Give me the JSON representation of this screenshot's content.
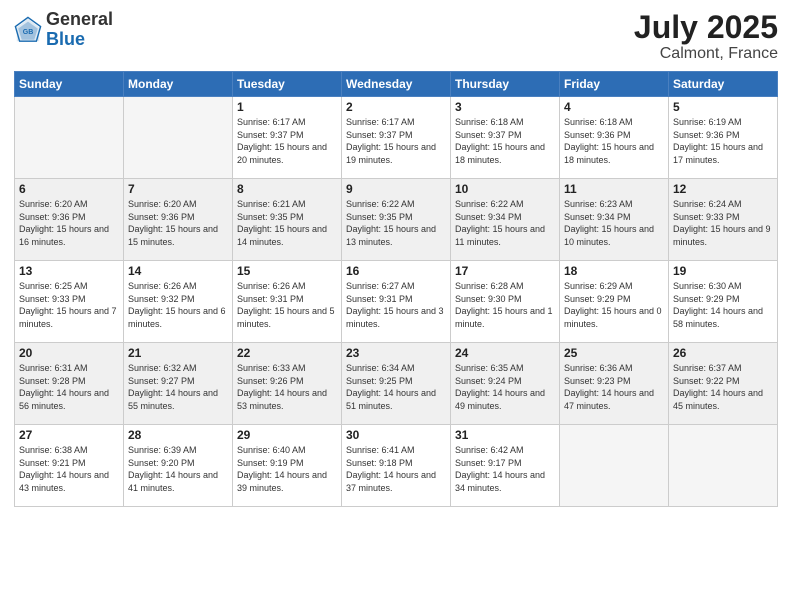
{
  "logo": {
    "general": "General",
    "blue": "Blue"
  },
  "header": {
    "month": "July 2025",
    "location": "Calmont, France"
  },
  "weekdays": [
    "Sunday",
    "Monday",
    "Tuesday",
    "Wednesday",
    "Thursday",
    "Friday",
    "Saturday"
  ],
  "weeks": [
    [
      {
        "day": "",
        "empty": true
      },
      {
        "day": "",
        "empty": true
      },
      {
        "day": "1",
        "sunrise": "Sunrise: 6:17 AM",
        "sunset": "Sunset: 9:37 PM",
        "daylight": "Daylight: 15 hours and 20 minutes."
      },
      {
        "day": "2",
        "sunrise": "Sunrise: 6:17 AM",
        "sunset": "Sunset: 9:37 PM",
        "daylight": "Daylight: 15 hours and 19 minutes."
      },
      {
        "day": "3",
        "sunrise": "Sunrise: 6:18 AM",
        "sunset": "Sunset: 9:37 PM",
        "daylight": "Daylight: 15 hours and 18 minutes."
      },
      {
        "day": "4",
        "sunrise": "Sunrise: 6:18 AM",
        "sunset": "Sunset: 9:36 PM",
        "daylight": "Daylight: 15 hours and 18 minutes."
      },
      {
        "day": "5",
        "sunrise": "Sunrise: 6:19 AM",
        "sunset": "Sunset: 9:36 PM",
        "daylight": "Daylight: 15 hours and 17 minutes."
      }
    ],
    [
      {
        "day": "6",
        "sunrise": "Sunrise: 6:20 AM",
        "sunset": "Sunset: 9:36 PM",
        "daylight": "Daylight: 15 hours and 16 minutes."
      },
      {
        "day": "7",
        "sunrise": "Sunrise: 6:20 AM",
        "sunset": "Sunset: 9:36 PM",
        "daylight": "Daylight: 15 hours and 15 minutes."
      },
      {
        "day": "8",
        "sunrise": "Sunrise: 6:21 AM",
        "sunset": "Sunset: 9:35 PM",
        "daylight": "Daylight: 15 hours and 14 minutes."
      },
      {
        "day": "9",
        "sunrise": "Sunrise: 6:22 AM",
        "sunset": "Sunset: 9:35 PM",
        "daylight": "Daylight: 15 hours and 13 minutes."
      },
      {
        "day": "10",
        "sunrise": "Sunrise: 6:22 AM",
        "sunset": "Sunset: 9:34 PM",
        "daylight": "Daylight: 15 hours and 11 minutes."
      },
      {
        "day": "11",
        "sunrise": "Sunrise: 6:23 AM",
        "sunset": "Sunset: 9:34 PM",
        "daylight": "Daylight: 15 hours and 10 minutes."
      },
      {
        "day": "12",
        "sunrise": "Sunrise: 6:24 AM",
        "sunset": "Sunset: 9:33 PM",
        "daylight": "Daylight: 15 hours and 9 minutes."
      }
    ],
    [
      {
        "day": "13",
        "sunrise": "Sunrise: 6:25 AM",
        "sunset": "Sunset: 9:33 PM",
        "daylight": "Daylight: 15 hours and 7 minutes."
      },
      {
        "day": "14",
        "sunrise": "Sunrise: 6:26 AM",
        "sunset": "Sunset: 9:32 PM",
        "daylight": "Daylight: 15 hours and 6 minutes."
      },
      {
        "day": "15",
        "sunrise": "Sunrise: 6:26 AM",
        "sunset": "Sunset: 9:31 PM",
        "daylight": "Daylight: 15 hours and 5 minutes."
      },
      {
        "day": "16",
        "sunrise": "Sunrise: 6:27 AM",
        "sunset": "Sunset: 9:31 PM",
        "daylight": "Daylight: 15 hours and 3 minutes."
      },
      {
        "day": "17",
        "sunrise": "Sunrise: 6:28 AM",
        "sunset": "Sunset: 9:30 PM",
        "daylight": "Daylight: 15 hours and 1 minute."
      },
      {
        "day": "18",
        "sunrise": "Sunrise: 6:29 AM",
        "sunset": "Sunset: 9:29 PM",
        "daylight": "Daylight: 15 hours and 0 minutes."
      },
      {
        "day": "19",
        "sunrise": "Sunrise: 6:30 AM",
        "sunset": "Sunset: 9:29 PM",
        "daylight": "Daylight: 14 hours and 58 minutes."
      }
    ],
    [
      {
        "day": "20",
        "sunrise": "Sunrise: 6:31 AM",
        "sunset": "Sunset: 9:28 PM",
        "daylight": "Daylight: 14 hours and 56 minutes."
      },
      {
        "day": "21",
        "sunrise": "Sunrise: 6:32 AM",
        "sunset": "Sunset: 9:27 PM",
        "daylight": "Daylight: 14 hours and 55 minutes."
      },
      {
        "day": "22",
        "sunrise": "Sunrise: 6:33 AM",
        "sunset": "Sunset: 9:26 PM",
        "daylight": "Daylight: 14 hours and 53 minutes."
      },
      {
        "day": "23",
        "sunrise": "Sunrise: 6:34 AM",
        "sunset": "Sunset: 9:25 PM",
        "daylight": "Daylight: 14 hours and 51 minutes."
      },
      {
        "day": "24",
        "sunrise": "Sunrise: 6:35 AM",
        "sunset": "Sunset: 9:24 PM",
        "daylight": "Daylight: 14 hours and 49 minutes."
      },
      {
        "day": "25",
        "sunrise": "Sunrise: 6:36 AM",
        "sunset": "Sunset: 9:23 PM",
        "daylight": "Daylight: 14 hours and 47 minutes."
      },
      {
        "day": "26",
        "sunrise": "Sunrise: 6:37 AM",
        "sunset": "Sunset: 9:22 PM",
        "daylight": "Daylight: 14 hours and 45 minutes."
      }
    ],
    [
      {
        "day": "27",
        "sunrise": "Sunrise: 6:38 AM",
        "sunset": "Sunset: 9:21 PM",
        "daylight": "Daylight: 14 hours and 43 minutes."
      },
      {
        "day": "28",
        "sunrise": "Sunrise: 6:39 AM",
        "sunset": "Sunset: 9:20 PM",
        "daylight": "Daylight: 14 hours and 41 minutes."
      },
      {
        "day": "29",
        "sunrise": "Sunrise: 6:40 AM",
        "sunset": "Sunset: 9:19 PM",
        "daylight": "Daylight: 14 hours and 39 minutes."
      },
      {
        "day": "30",
        "sunrise": "Sunrise: 6:41 AM",
        "sunset": "Sunset: 9:18 PM",
        "daylight": "Daylight: 14 hours and 37 minutes."
      },
      {
        "day": "31",
        "sunrise": "Sunrise: 6:42 AM",
        "sunset": "Sunset: 9:17 PM",
        "daylight": "Daylight: 14 hours and 34 minutes."
      },
      {
        "day": "",
        "empty": true
      },
      {
        "day": "",
        "empty": true
      }
    ]
  ]
}
